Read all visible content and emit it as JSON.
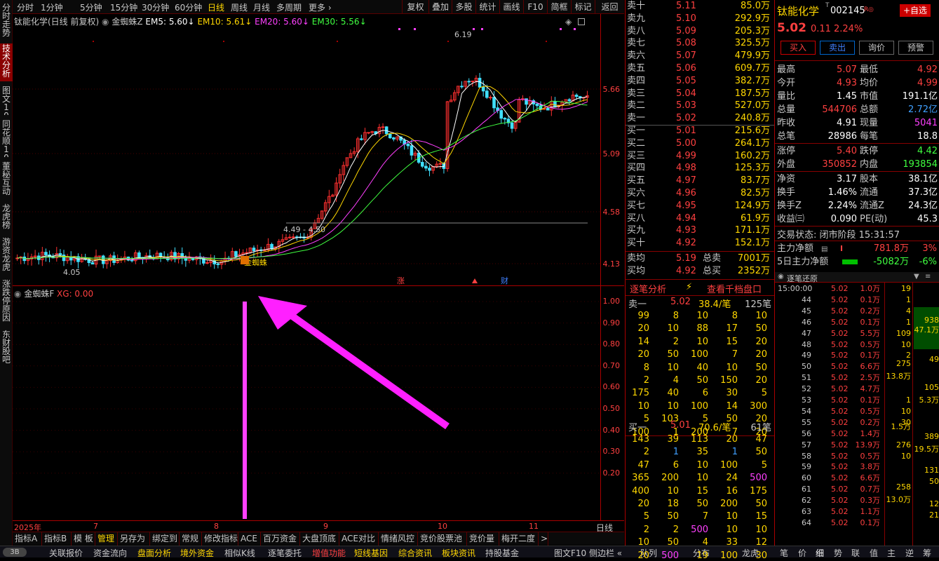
{
  "left_tabs": [
    "分时走势",
    "技术分析",
    "图文10",
    "同花顺10",
    "董秘互动",
    "龙虎榜",
    "游资龙虎",
    "涨跌停原因",
    "东财股吧"
  ],
  "period_tabs": [
    "分时",
    "1分钟",
    "5分钟",
    "15分钟",
    "30分钟",
    "60分钟",
    "日线",
    "周线",
    "月线",
    "多周期",
    "更多 ›"
  ],
  "tools": [
    "复权",
    "叠加",
    "多股",
    "统计",
    "画线",
    "F10",
    "简框",
    "标记",
    "返回"
  ],
  "chart_header": {
    "name": "钛能化学(日线 前复权)",
    "ind": "金蜘蛛Z",
    "em5": "EM5: 5.60",
    "em10": "EM10: 5.61",
    "em20": "EM20: 5.60",
    "em30": "EM30: 5.56"
  },
  "chart_data": {
    "type": "candlestick",
    "price_ticks": [
      "5.66",
      "5.09",
      "4.58",
      "4.13"
    ],
    "high_label": "6.19",
    "low_label": "4.05",
    "range_label": "4.49 - 4.50",
    "signal_label": "金蜘蛛",
    "markers": [
      "涨",
      "财"
    ],
    "x_ticks": [
      "2025年",
      "7",
      "8",
      "9",
      "10",
      "11"
    ],
    "sub_title": "金蜘蛛F",
    "sub_value": "XG: 0.00",
    "sub_ticks": [
      "1.00",
      "0.90",
      "0.80",
      "0.70",
      "0.60",
      "0.50",
      "0.40",
      "0.30",
      "0.20"
    ]
  },
  "period_label": "日线",
  "bottom_tabs": [
    "指标A",
    "指标B",
    "模 板",
    "管理",
    "另存为",
    "绑定到",
    "常规",
    "修改指标",
    "ACE",
    "百万资金",
    "大盘顶底",
    "ACE对比",
    "情绪风控",
    "竞价股票池",
    "竞价量",
    "梅开二度",
    ">"
  ],
  "statusbar": [
    "关联报价",
    "资金流向",
    "盘面分析",
    "境外资金",
    "相似K线",
    "逐笔委托",
    "增值功能",
    "短线基因",
    "综合资讯",
    "板块资讯",
    "持股基金",
    "图文F10 侧边栏 «"
  ],
  "status_right": [
    "队列",
    "分布",
    "龙虎",
    "笔",
    "价",
    "细",
    "势",
    "联",
    "值",
    "主",
    "逆",
    "筹"
  ],
  "orderbook": {
    "sell": [
      [
        "卖十",
        "5.11",
        "85.0万"
      ],
      [
        "卖九",
        "5.10",
        "292.9万"
      ],
      [
        "卖八",
        "5.09",
        "205.3万"
      ],
      [
        "卖七",
        "5.08",
        "325.5万"
      ],
      [
        "卖六",
        "5.07",
        "479.9万"
      ],
      [
        "卖五",
        "5.06",
        "609.7万"
      ],
      [
        "卖四",
        "5.05",
        "382.7万"
      ],
      [
        "卖三",
        "5.04",
        "187.5万"
      ],
      [
        "卖二",
        "5.03",
        "527.0万"
      ],
      [
        "卖一",
        "5.02",
        "240.8万"
      ]
    ],
    "buy": [
      [
        "买一",
        "5.01",
        "215.6万"
      ],
      [
        "买二",
        "5.00",
        "264.1万"
      ],
      [
        "买三",
        "4.99",
        "160.2万"
      ],
      [
        "买四",
        "4.98",
        "125.3万"
      ],
      [
        "买五",
        "4.97",
        "83.7万"
      ],
      [
        "买六",
        "4.96",
        "82.5万"
      ],
      [
        "买七",
        "4.95",
        "124.9万"
      ],
      [
        "买八",
        "4.94",
        "61.9万"
      ],
      [
        "买九",
        "4.93",
        "171.1万"
      ],
      [
        "买十",
        "4.92",
        "152.1万"
      ]
    ],
    "avg_sell": [
      "卖均",
      "5.19",
      "总卖",
      "7001万"
    ],
    "avg_buy": [
      "买均",
      "4.92",
      "总买",
      "2352万"
    ]
  },
  "stock": {
    "name": "钛能化学",
    "code": "002145",
    "price": "5.02",
    "change": "0.11",
    "pct": "2.24%",
    "add_btn": "+自选",
    "actions": [
      "买入",
      "卖出",
      "询价",
      "预警"
    ]
  },
  "detail_rows": [
    [
      "最高",
      "5.07",
      "最低",
      "4.92"
    ],
    [
      "今开",
      "4.93",
      "均价",
      "4.99"
    ],
    [
      "量比",
      "1.45",
      "市值",
      "191.1亿"
    ],
    [
      "总量",
      "544706",
      "总额",
      "2.72亿"
    ],
    [
      "昨收",
      "4.91",
      "现量",
      "5041"
    ],
    [
      "总笔",
      "28986",
      "每笔",
      "18.8"
    ],
    [
      "涨停",
      "5.40",
      "跌停",
      "4.42"
    ],
    [
      "外盘",
      "350852",
      "内盘",
      "193854"
    ],
    [
      "净资",
      "3.17",
      "股本",
      "38.1亿"
    ],
    [
      "换手",
      "1.46%",
      "流通",
      "37.3亿"
    ],
    [
      "换手Z",
      "2.24%",
      "流通Z",
      "24.3亿"
    ],
    [
      "收益㈢",
      "0.090",
      "PE(动)",
      "45.3"
    ]
  ],
  "trade_status": "交易状态: 闭市阶段 15:31:57",
  "main_flow": [
    "主力净额",
    "781.8万",
    "3%"
  ],
  "flow5": [
    "5日主力净额",
    "-5082万",
    "-6%"
  ],
  "tick_panel": {
    "title": "逐笔分析",
    "title2": "查看千档盘口",
    "sell_head": [
      "卖一",
      "5.02",
      "38.4/笔",
      "125笔"
    ],
    "buy_head": [
      "买一",
      "5.01",
      "70.6/笔",
      "61笔"
    ],
    "sell_grid": [
      [
        "99",
        "8",
        "10",
        "8",
        "10"
      ],
      [
        "20",
        "10",
        "88",
        "17",
        "50"
      ],
      [
        "14",
        "2",
        "10",
        "15",
        "20"
      ],
      [
        "20",
        "50",
        "100",
        "7",
        "20"
      ],
      [
        "8",
        "10",
        "40",
        "10",
        "50"
      ],
      [
        "2",
        "4",
        "50",
        "150",
        "20"
      ],
      [
        "175",
        "40",
        "6",
        "30",
        "5"
      ],
      [
        "10",
        "10",
        "100",
        "14",
        "300"
      ],
      [
        "5",
        "103",
        "5",
        "50",
        "20"
      ],
      [
        "100",
        "1",
        "200",
        "7",
        "20"
      ]
    ],
    "buy_grid": [
      [
        "143",
        "39",
        "113",
        "20",
        "47"
      ],
      [
        "2",
        "1",
        "35",
        "1",
        "50"
      ],
      [
        "47",
        "6",
        "10",
        "100",
        "5"
      ],
      [
        "365",
        "200",
        "10",
        "24",
        "500"
      ],
      [
        "400",
        "10",
        "15",
        "16",
        "175"
      ],
      [
        "20",
        "18",
        "50",
        "200",
        "50"
      ],
      [
        "5",
        "50",
        "7",
        "10",
        "15"
      ],
      [
        "2",
        "2",
        "500",
        "10",
        "10"
      ],
      [
        "10",
        "50",
        "4",
        "33",
        "12"
      ],
      [
        "20",
        "500",
        "19",
        "100",
        "30"
      ]
    ]
  },
  "trades_title": "逐笔还原",
  "trades": [
    [
      "15:00:00",
      "5.02",
      "1.0万",
      "19"
    ],
    [
      "44",
      "5.02",
      "0.1万",
      "1"
    ],
    [
      "45",
      "5.02",
      "0.2万",
      "4"
    ],
    [
      "46",
      "5.02",
      "0.1万",
      "1"
    ],
    [
      "47",
      "5.02",
      "5.5万",
      "109"
    ],
    [
      "48",
      "5.02",
      "0.5万",
      "10"
    ],
    [
      "49",
      "5.02",
      "0.1万",
      "2"
    ],
    [
      "50",
      "5.02",
      "6.6万",
      ""
    ],
    [
      "51",
      "5.02",
      "2.5万",
      ""
    ],
    [
      "52",
      "5.02",
      "4.7万",
      ""
    ],
    [
      "53",
      "5.02",
      "0.1万",
      "1"
    ],
    [
      "54",
      "5.02",
      "0.5万",
      "10"
    ],
    [
      "55",
      "5.02",
      "0.2万",
      "30"
    ],
    [
      "56",
      "5.02",
      "1.4万",
      ""
    ],
    [
      "57",
      "5.02",
      "13.9万",
      "276"
    ],
    [
      "58",
      "5.02",
      "0.5万",
      "10"
    ],
    [
      "59",
      "5.02",
      "3.8万",
      ""
    ],
    [
      "60",
      "5.02",
      "6.6万",
      ""
    ],
    [
      "61",
      "5.02",
      "0.7万",
      ""
    ],
    [
      "62",
      "5.02",
      "0.3万",
      ""
    ],
    [
      "63",
      "5.02",
      "1.1万",
      ""
    ],
    [
      "64",
      "5.02",
      "0.1万",
      ""
    ]
  ],
  "trade_side": [
    "938",
    "47.1万",
    "49",
    "275",
    "13.8万",
    "105",
    "5.3万",
    "1.5万",
    "389",
    "19.5万",
    "131",
    "50",
    "258",
    "13.0万",
    "12",
    "21"
  ]
}
